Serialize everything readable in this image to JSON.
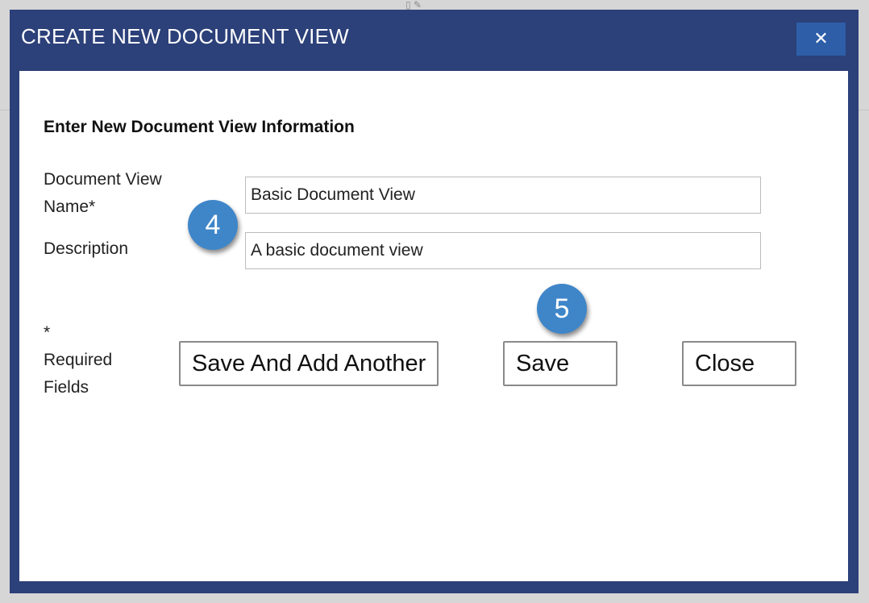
{
  "dialog": {
    "title": "CREATE NEW DOCUMENT VIEW",
    "close_icon": "close-icon",
    "close_glyph": "✕"
  },
  "form": {
    "heading": "Enter New Document View Information",
    "fields": [
      {
        "label": "Document View Name*",
        "value": "Basic Document View"
      },
      {
        "label": "Description",
        "value": "A basic document view"
      }
    ],
    "required_note_star": "*",
    "required_note_text": "Required Fields"
  },
  "buttons": {
    "save_and_add": "Save And Add Another",
    "save": "Save",
    "close": "Close"
  },
  "callouts": {
    "step_4": "4",
    "step_5": "5"
  },
  "colors": {
    "dialog_header": "#2c4079",
    "close_button": "#2e5ea8",
    "callout": "#3f86c9"
  }
}
